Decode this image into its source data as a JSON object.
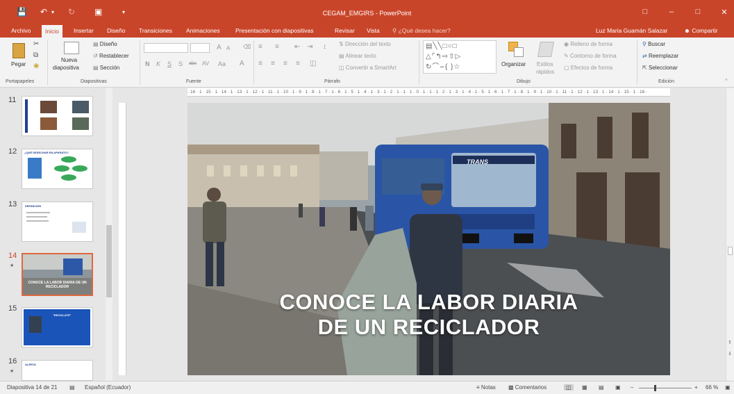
{
  "window": {
    "title": "CEGAM_EMGIRS - PowerPoint",
    "accent": "#c9452a"
  },
  "quick_access": {
    "save_icon": "save-icon",
    "undo_icon": "undo-icon",
    "redo_icon": "redo-icon",
    "present_icon": "present-icon"
  },
  "menu": {
    "tabs": [
      "Archivo",
      "Inicio",
      "Insertar",
      "Diseño",
      "Transiciones",
      "Animaciones",
      "Presentación con diapositivas",
      "Revisar",
      "Vista"
    ],
    "active_tab": "Inicio",
    "tell_me": "¿Qué desea hacer?",
    "user_name": "Luz Maria Guamán Salazar",
    "share": "Compartir"
  },
  "ribbon": {
    "portapapeles": {
      "label": "Portapapeles",
      "paste": "Pegar"
    },
    "diapositivas": {
      "label": "Diapositivas",
      "new_slide_1": "Nueva",
      "new_slide_2": "diapositiva",
      "layout": "Diseño",
      "reset": "Restablecer",
      "section": "Sección"
    },
    "fuente": {
      "label": "Fuente",
      "bold": "N",
      "italic": "K",
      "underline": "S",
      "strike": "S",
      "shadow": "abc",
      "spacing": "AV",
      "case": "Aa",
      "grow": "A",
      "shrink": "A",
      "color": "A"
    },
    "parrafo": {
      "label": "Párrafo",
      "text_direction": "Dirección del texto",
      "align_text": "Alinear texto",
      "smartart": "Convertir a SmartArt"
    },
    "dibujo": {
      "label": "Dibujo",
      "arrange": "Organizar",
      "quick_styles_1": "Estilos",
      "quick_styles_2": "rápidos",
      "fill": "Relleno de forma",
      "outline": "Contorno de forma",
      "effects": "Efectos de forma"
    },
    "edicion": {
      "label": "Edición",
      "find": "Buscar",
      "replace": "Reemplazar",
      "select": "Seleccionar"
    }
  },
  "thumbnails": [
    {
      "num": "11",
      "caption": ""
    },
    {
      "num": "12",
      "caption": "¿QUÉ DESECHAR EN APARATO?"
    },
    {
      "num": "13",
      "caption": "DEFINICIÓN"
    },
    {
      "num": "14",
      "caption": "CONOCE LA LABOR DIARIA DE UN RECICLADOR",
      "selected": true
    },
    {
      "num": "15",
      "caption": "\"RECICLATE\""
    },
    {
      "num": "16",
      "caption": "ALERTA"
    }
  ],
  "ruler": {
    "ticks": "· 16 · 1 · 15 · 1 · 14 · 1 · 13 · 1 · 12 · 1 · 11 · 1 · 10 · 1 · 9 · 1 · 8 · 1 · 7 · 1 · 6 · 1 · 5 · 1 · 4 · 1 · 3 · 1 · 2 · 1 · 1 · 1 · 0 · 1 · 1 · 1 · 2 · 1 · 3 · 1 · 4 · 1 · 5 · 1 · 6 · 1 · 7 · 1 · 8 · 1 · 9 · 1 · 10 · 1 · 11 · 1 · 12 · 1 · 13 · 1 · 14 · 1 · 15 · 1 · 16 ·"
  },
  "slide": {
    "title_line1": "CONOCE LA LABOR DIARIA",
    "title_line2": "DE UN RECICLADOR",
    "bus_sign": "TRANS"
  },
  "status": {
    "slide_counter": "Diapositiva 14 de 21",
    "language": "Español (Ecuador)",
    "notes": "Notas",
    "comments": "Comentarios",
    "zoom": "66 %"
  }
}
